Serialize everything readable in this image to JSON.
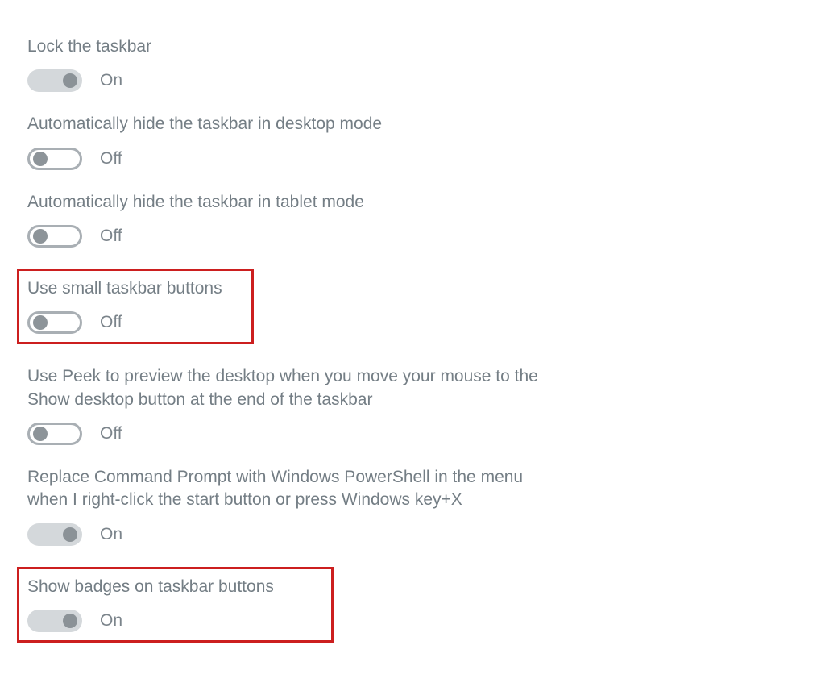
{
  "status_labels": {
    "on": "On",
    "off": "Off"
  },
  "settings": {
    "lock_taskbar": {
      "label": "Lock the taskbar",
      "state": "on"
    },
    "autohide_desktop": {
      "label": "Automatically hide the taskbar in desktop mode",
      "state": "off"
    },
    "autohide_tablet": {
      "label": "Automatically hide the taskbar in tablet mode",
      "state": "off"
    },
    "small_buttons": {
      "label": "Use small taskbar buttons",
      "state": "off"
    },
    "peek_preview": {
      "label": "Use Peek to preview the desktop when you move your mouse to the Show desktop button at the end of the taskbar",
      "state": "off"
    },
    "powershell_replace": {
      "label": "Replace Command Prompt with Windows PowerShell in the menu when I right-click the start button or press Windows key+X",
      "state": "on"
    },
    "show_badges": {
      "label": "Show badges on taskbar buttons",
      "state": "on"
    }
  },
  "highlight_color": "#cc1f1f"
}
